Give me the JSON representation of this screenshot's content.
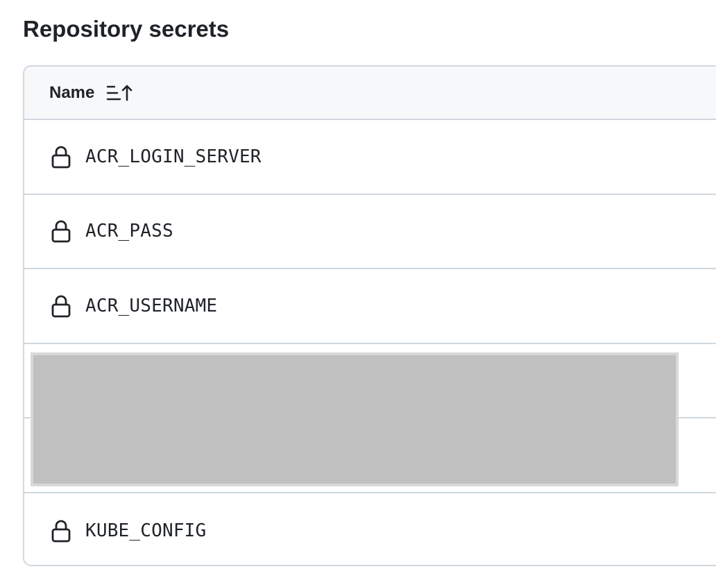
{
  "section": {
    "title": "Repository secrets"
  },
  "table": {
    "column_header": "Name",
    "sort_icon": "sort-ascending-icon",
    "rows": [
      {
        "name": "ACR_LOGIN_SERVER",
        "icon": "lock-icon"
      },
      {
        "name": "ACR_PASS",
        "icon": "lock-icon"
      },
      {
        "name": "ACR_USERNAME",
        "icon": "lock-icon"
      },
      {
        "name": "",
        "icon": ""
      },
      {
        "name": "",
        "icon": ""
      },
      {
        "name": "KUBE_CONFIG",
        "icon": "lock-icon"
      }
    ]
  },
  "colors": {
    "border": "#d0d7de",
    "header_bg": "#f6f8fa",
    "text": "#1f2328",
    "redaction": "#c0c0c0"
  }
}
